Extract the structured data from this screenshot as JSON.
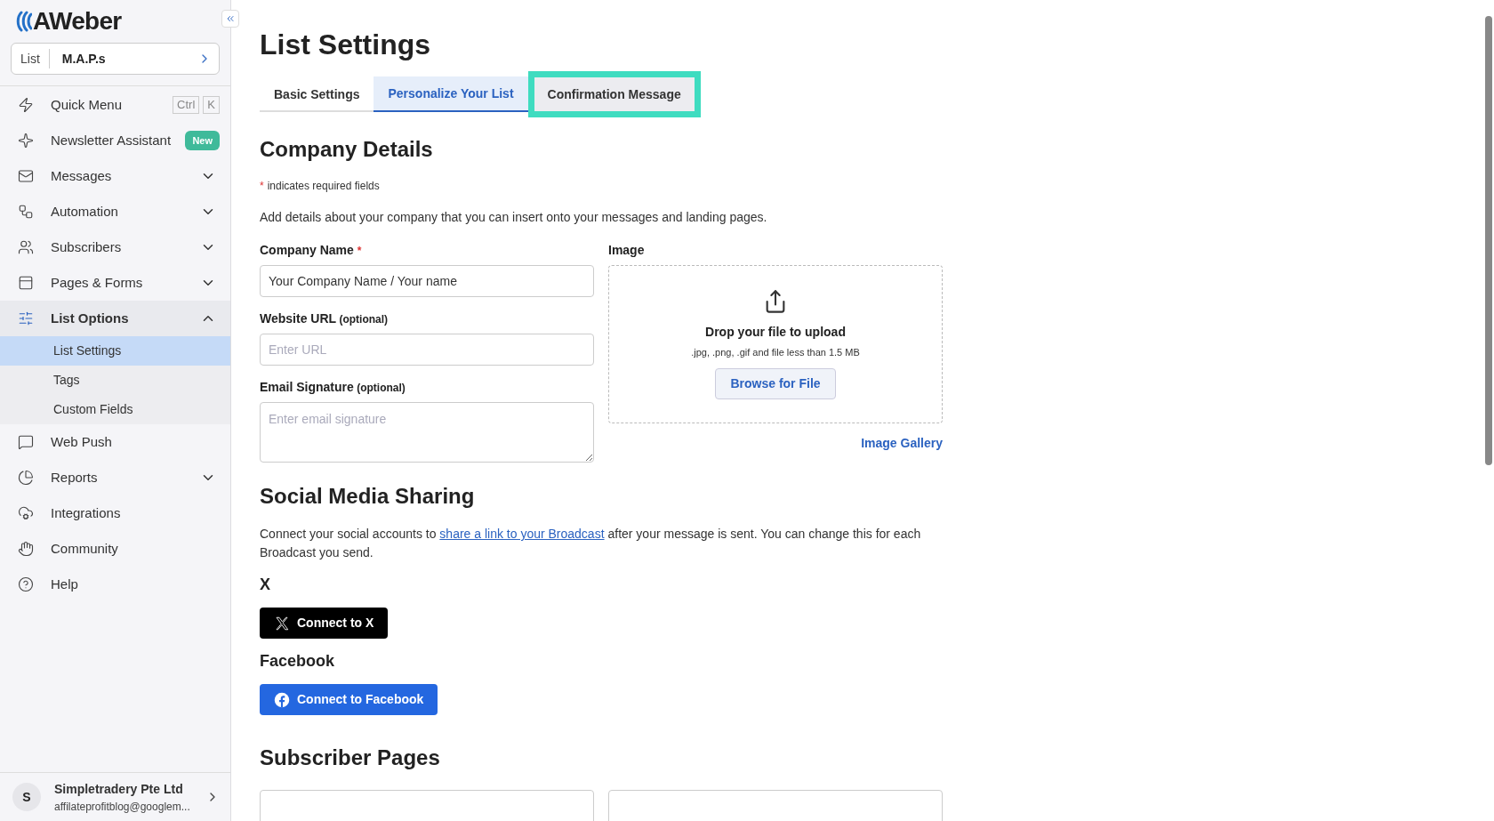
{
  "sidebar": {
    "logo": "AWeber",
    "list_selector": {
      "label": "List",
      "value": "M.A.P.s"
    },
    "items": [
      {
        "kind": "shortcut",
        "label": "Quick Menu",
        "keys": [
          "Ctrl",
          "K"
        ]
      },
      {
        "kind": "badge",
        "label": "Newsletter Assistant",
        "badge": "New"
      },
      {
        "kind": "group",
        "label": "Messages",
        "expanded": false
      },
      {
        "kind": "group",
        "label": "Automation",
        "expanded": false
      },
      {
        "kind": "group",
        "label": "Subscribers",
        "expanded": false
      },
      {
        "kind": "group",
        "label": "Pages & Forms",
        "expanded": false
      },
      {
        "kind": "group",
        "label": "List Options",
        "expanded": true,
        "children": [
          {
            "label": "List Settings",
            "selected": true
          },
          {
            "label": "Tags",
            "selected": false
          },
          {
            "label": "Custom Fields",
            "selected": false
          }
        ]
      },
      {
        "kind": "link",
        "label": "Web Push"
      },
      {
        "kind": "group",
        "label": "Reports",
        "expanded": false
      },
      {
        "kind": "link",
        "label": "Integrations"
      },
      {
        "kind": "link",
        "label": "Community"
      },
      {
        "kind": "link",
        "label": "Help"
      }
    ],
    "account": {
      "initial": "S",
      "name": "Simpletradery Pte Ltd",
      "email": "affilateprofitblog@googlem..."
    }
  },
  "page": {
    "title": "List Settings",
    "tabs": [
      {
        "label": "Basic Settings",
        "selected": false,
        "highlighted": false
      },
      {
        "label": "Personalize Your List",
        "selected": true,
        "highlighted": false
      },
      {
        "label": "Confirmation Message",
        "selected": false,
        "highlighted": true
      }
    ],
    "company_details": {
      "heading": "Company Details",
      "required_note": "indicates required fields",
      "required_mark": "*",
      "description": "Add details about your company that you can insert onto your messages and landing pages.",
      "fields": [
        {
          "kind": "input",
          "label": "Company Name",
          "required_mark": "*",
          "value": "Your Company Name / Your name"
        },
        {
          "kind": "input",
          "label": "Website URL",
          "hint": "(optional)",
          "placeholder": "Enter URL"
        },
        {
          "kind": "textarea",
          "label": "Email Signature",
          "hint": "(optional)",
          "placeholder": "Enter email signature"
        }
      ],
      "image": {
        "label": "Image",
        "drop_title": "Drop your file to upload",
        "drop_note": ".jpg, .png, .gif and file less than 1.5 MB",
        "browse_button": "Browse for File",
        "gallery_link": "Image Gallery"
      }
    },
    "social": {
      "heading": "Social Media Sharing",
      "text_before": "Connect your social accounts to",
      "link": "share a link to your Broadcast",
      "text_after": "after your message is sent. You can change this for each Broadcast you send.",
      "networks": [
        {
          "kind": "x",
          "name": "X",
          "button": "Connect to X"
        },
        {
          "kind": "facebook",
          "name": "Facebook",
          "button": "Connect to Facebook"
        }
      ]
    },
    "subscriber_pages": {
      "heading": "Subscriber Pages"
    }
  }
}
